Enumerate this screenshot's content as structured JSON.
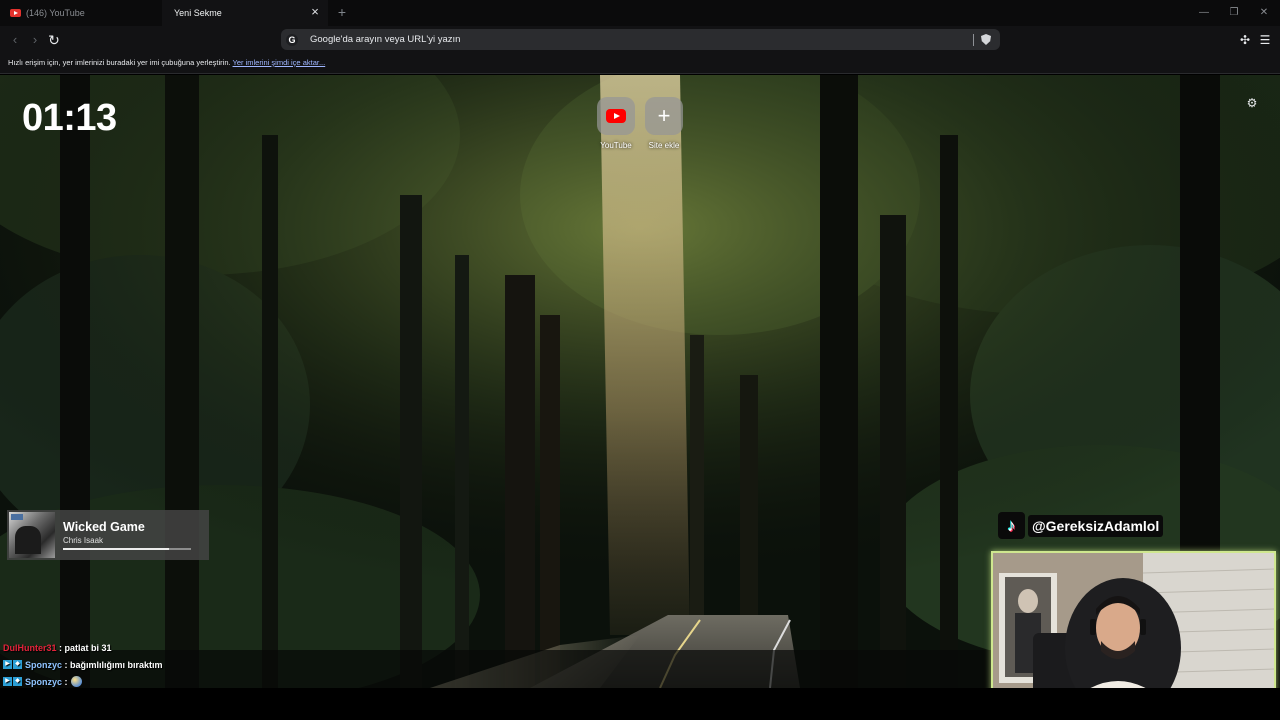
{
  "browser": {
    "tabs": [
      {
        "title": "(146) YouTube"
      },
      {
        "title": "Yeni Sekme"
      }
    ],
    "omnibox": {
      "placeholder": "Google'da arayın veya URL'yi yazın"
    },
    "bookmark_bar": {
      "text": "Hızlı erişim için, yer imlerinizi buradaki yer imi çubuğuna yerleştirin.",
      "link": "Yer imlerini şimdi içe aktar..."
    }
  },
  "new_tab": {
    "clock": "01:13",
    "shortcuts": [
      {
        "label": "YouTube",
        "icon": "youtube-icon"
      },
      {
        "label": "Site ekle",
        "icon": "plus-icon"
      }
    ]
  },
  "overlay": {
    "now_playing": {
      "title": "Wicked Game",
      "artist": "Chris Isaak",
      "progress": 0.83
    },
    "chat": [
      {
        "user": "DulHunter31",
        "message": "patlat bi 31",
        "badge": false
      },
      {
        "user": "Sponzyc",
        "message": "bağımlılığımı bıraktım",
        "badge": true
      },
      {
        "user": "Sponzyc",
        "message": "",
        "badge": true,
        "emote": true
      }
    ],
    "tiktok": {
      "handle": "@GereksizAdamlol"
    }
  },
  "colors": {
    "accent": "#9fb6ff",
    "webcam_border": "#cfe78f",
    "youtube_red": "#ff0000",
    "chat_red": "#e3233a"
  }
}
